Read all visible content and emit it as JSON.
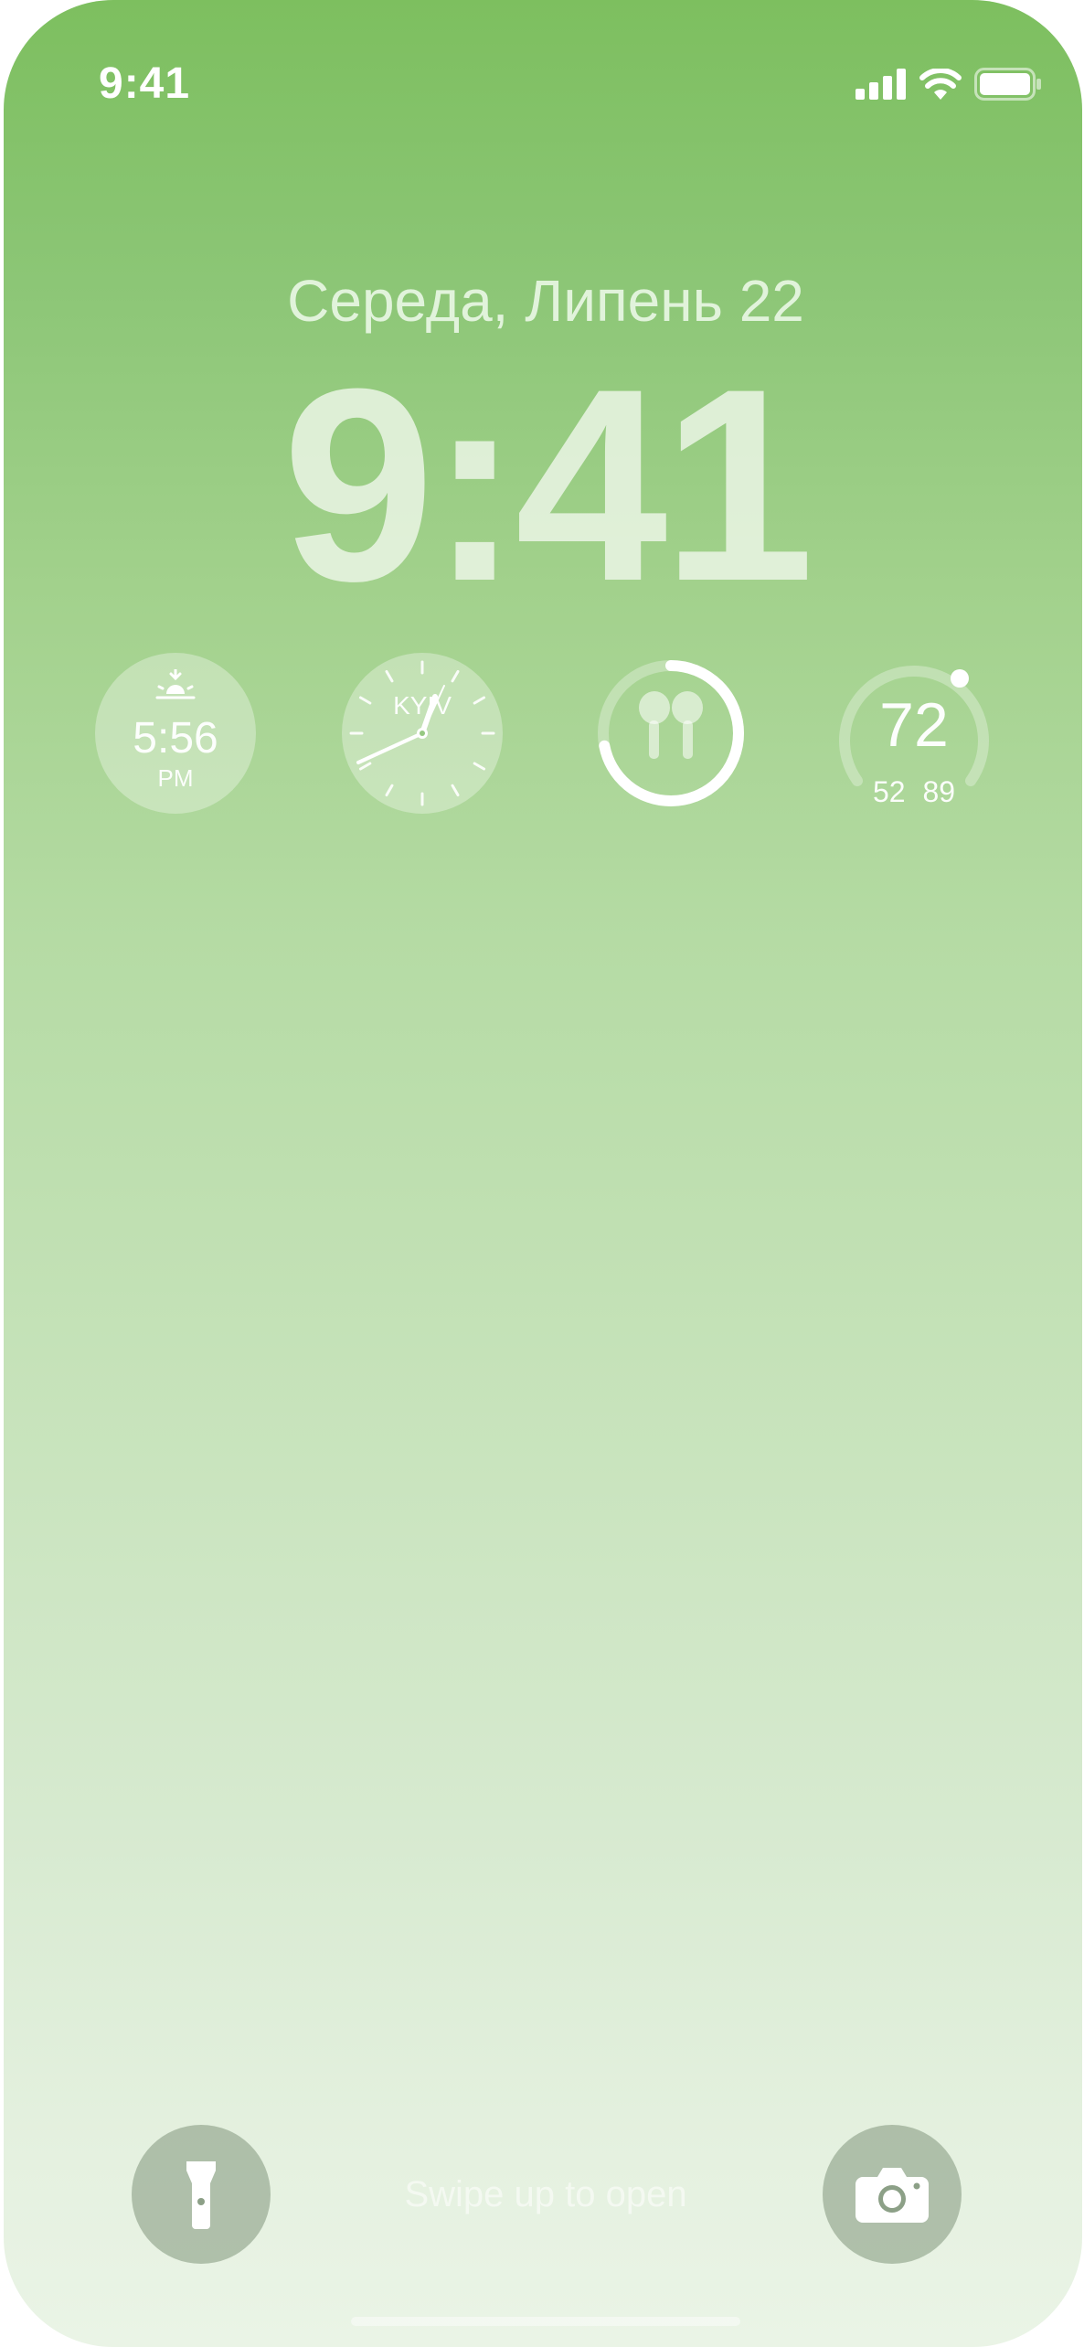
{
  "status_bar": {
    "time": "9:41",
    "icons": [
      "cellular-signal-icon",
      "wifi-icon",
      "battery-icon"
    ]
  },
  "lock_screen": {
    "date": "Середа, Липень 22",
    "time": "9:41"
  },
  "widgets": {
    "sunset": {
      "icon": "sunset-icon",
      "time": "5:56",
      "ampm": "PM"
    },
    "world_clock": {
      "city": "KYIV"
    },
    "airpods_battery": {
      "icon": "airpods-icon",
      "level": 0.72
    },
    "weather": {
      "temperature": "72",
      "low": "52",
      "high": "89"
    }
  },
  "bottom": {
    "flashlight_icon": "flashlight-icon",
    "camera_icon": "camera-icon",
    "swipe_hint": "Swipe up to open"
  },
  "colors": {
    "gradient_top": "#7dbf5f",
    "gradient_bottom": "#eaf4e6",
    "text_light": "#ffffff"
  }
}
